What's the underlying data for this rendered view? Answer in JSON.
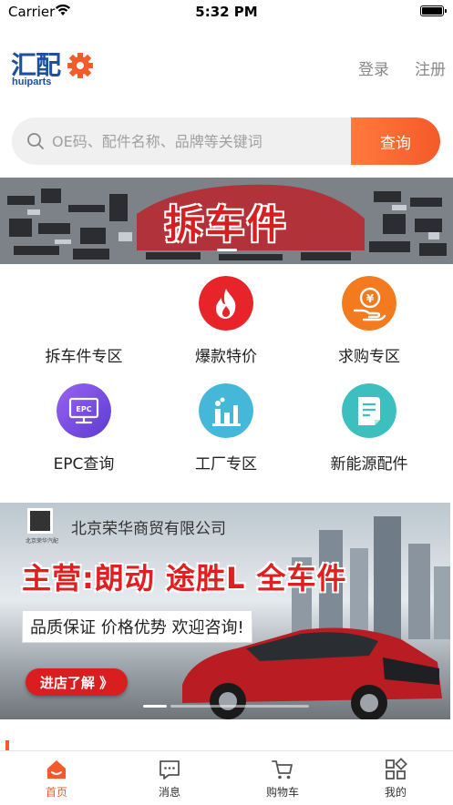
{
  "status_bar": {
    "carrier": "Carrier",
    "time": "5:32 PM"
  },
  "header": {
    "logo_cn": "汇配",
    "logo_en": "huiparts",
    "login": "登录",
    "register": "注册"
  },
  "search": {
    "placeholder": "OE码、配件名称、品牌等关键词",
    "button": "查询"
  },
  "banner1": {
    "title": "拆车件"
  },
  "categories": [
    {
      "label": "拆车件专区",
      "icon": "dismantled-parts-icon",
      "color": ""
    },
    {
      "label": "爆款特价",
      "icon": "fire-icon",
      "color": "#e8242b"
    },
    {
      "label": "求购专区",
      "icon": "purchase-icon",
      "color": "#f47a1f"
    },
    {
      "label": "EPC查询",
      "icon": "epc-icon",
      "color": "#7b4fe0"
    },
    {
      "label": "工厂专区",
      "icon": "factory-icon",
      "color": "#45b7d9"
    },
    {
      "label": "新能源配件",
      "icon": "document-icon",
      "color": "#3dbfbf"
    }
  ],
  "banner2": {
    "company": "北京荣华商贸有限公司",
    "logo_text": "北京荣华汽配",
    "headline": "主营:朗动 途胜L 全车件",
    "subline": "品质保证 价格优势 欢迎咨询!",
    "cta": "进店了解 》"
  },
  "tabbar": [
    {
      "label": "首页",
      "icon": "home-icon",
      "active": true
    },
    {
      "label": "消息",
      "icon": "message-icon",
      "active": false
    },
    {
      "label": "购物车",
      "icon": "cart-icon",
      "active": false
    },
    {
      "label": "我的",
      "icon": "profile-grid-icon",
      "active": false
    }
  ],
  "colors": {
    "accent": "#f45a2a",
    "brand": "#1d4fa1"
  }
}
